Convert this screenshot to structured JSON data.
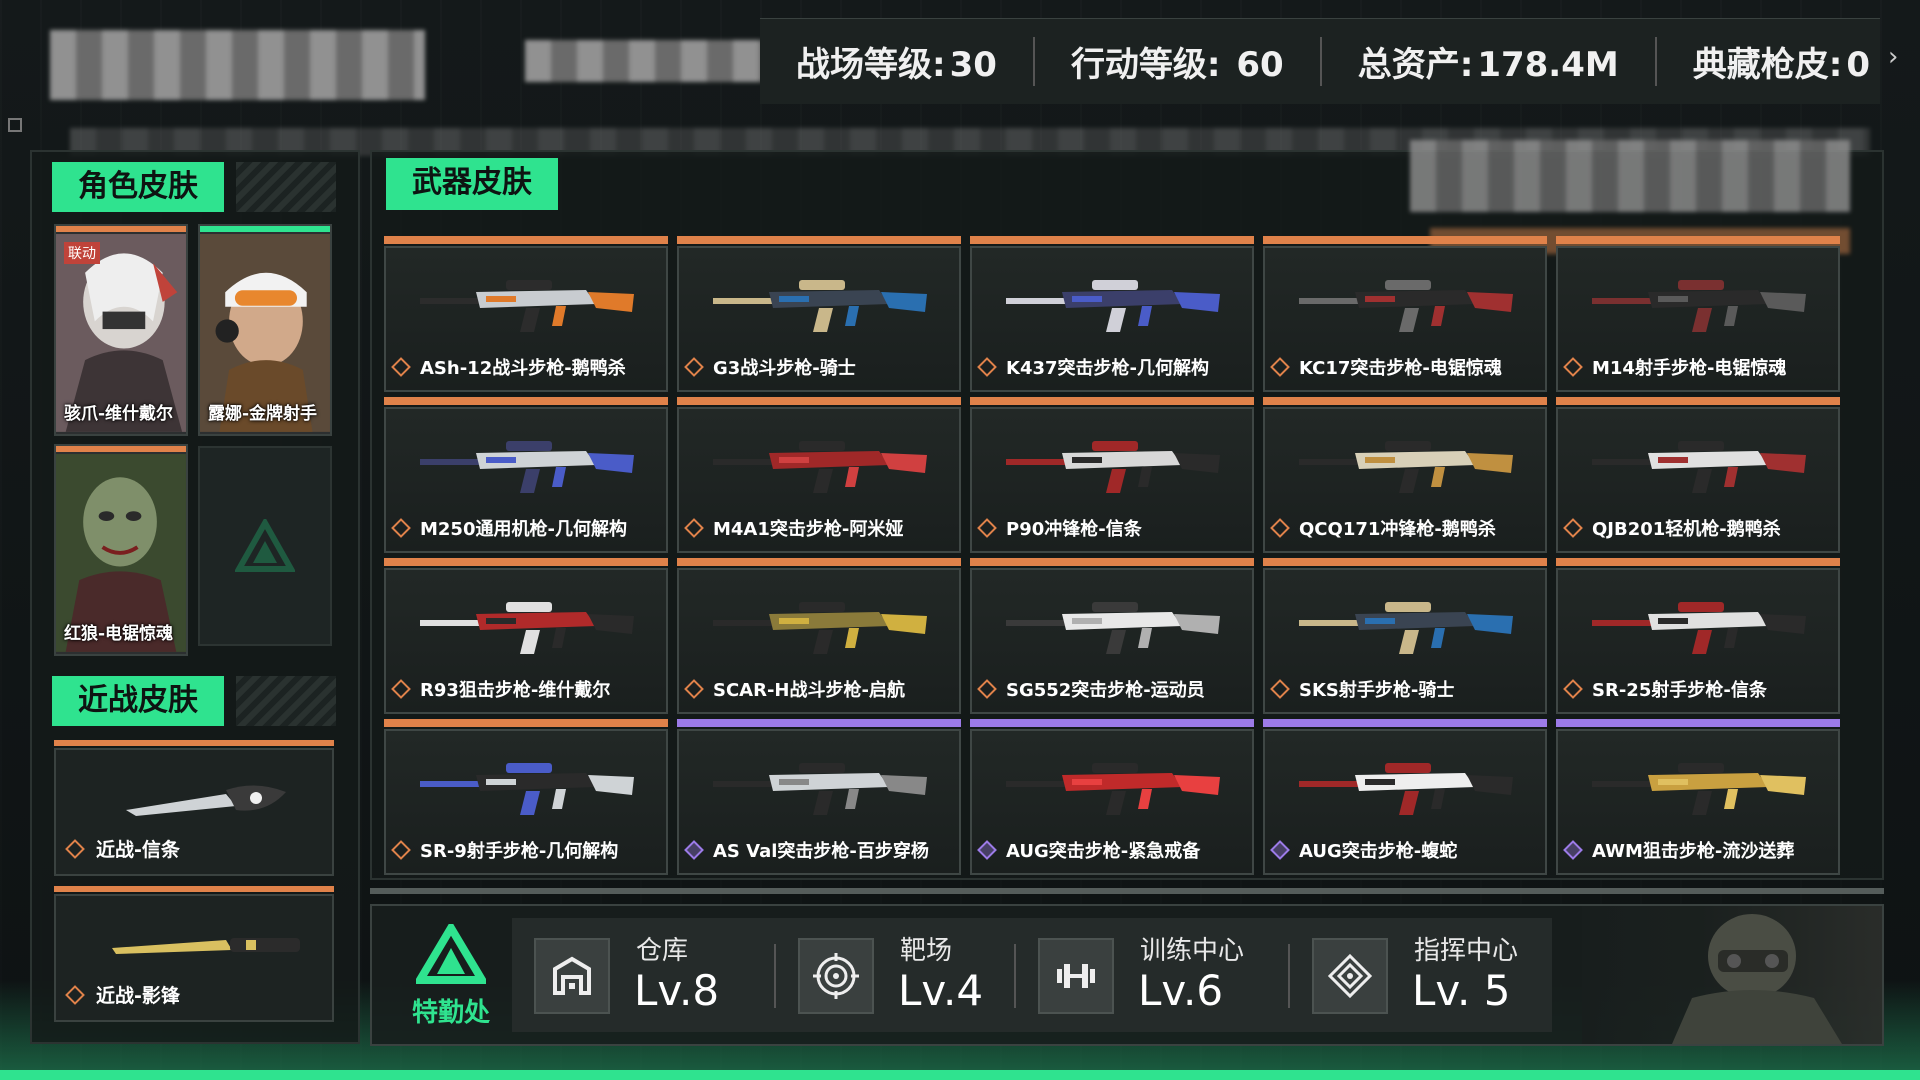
{
  "header": {
    "stats": [
      {
        "label": "战场等级:",
        "value": "30"
      },
      {
        "label": "行动等级: ",
        "value": "60"
      },
      {
        "label": "总资产:",
        "value": "178.4M"
      },
      {
        "label": "典藏枪皮:",
        "value": "0"
      }
    ]
  },
  "sections": {
    "character": "角色皮肤",
    "weapon": "武器皮肤",
    "melee": "近战皮肤"
  },
  "characters": [
    {
      "label": "骇爪-维什戴尔",
      "tag": "联动",
      "bar_color": "#e0824a"
    },
    {
      "label": "露娜-金牌射手",
      "bar_color": "#2fe38f"
    },
    {
      "label": "红狼-电锯惊魂",
      "bar_color": "#e0824a"
    }
  ],
  "melee": [
    {
      "label": "近战-信条"
    },
    {
      "label": "近战-影锋"
    }
  ],
  "weapons": [
    {
      "label": "ASh-12战斗步枪-鹅鸭杀",
      "rarity": "orange"
    },
    {
      "label": "G3战斗步枪-骑士",
      "rarity": "orange"
    },
    {
      "label": "K437突击步枪-几何解构",
      "rarity": "orange"
    },
    {
      "label": "KC17突击步枪-电锯惊魂",
      "rarity": "orange"
    },
    {
      "label": "M14射手步枪-电锯惊魂",
      "rarity": "orange"
    },
    {
      "label": "M250通用机枪-几何解构",
      "rarity": "orange"
    },
    {
      "label": "M4A1突击步枪-阿米娅",
      "rarity": "orange"
    },
    {
      "label": "P90冲锋枪-信条",
      "rarity": "orange"
    },
    {
      "label": "QCQ171冲锋枪-鹅鸭杀",
      "rarity": "orange"
    },
    {
      "label": "QJB201轻机枪-鹅鸭杀",
      "rarity": "orange"
    },
    {
      "label": "R93狙击步枪-维什戴尔",
      "rarity": "orange"
    },
    {
      "label": "SCAR-H战斗步枪-启航",
      "rarity": "orange"
    },
    {
      "label": "SG552突击步枪-运动员",
      "rarity": "orange"
    },
    {
      "label": "SKS射手步枪-骑士",
      "rarity": "orange"
    },
    {
      "label": "SR-25射手步枪-信条",
      "rarity": "orange"
    },
    {
      "label": "SR-9射手步枪-几何解构",
      "rarity": "orange"
    },
    {
      "label": "AS Val突击步枪-百步穿杨",
      "rarity": "purple"
    },
    {
      "label": "AUG突击步枪-紧急戒备",
      "rarity": "purple"
    },
    {
      "label": "AUG突击步枪-蝮蛇",
      "rarity": "purple"
    },
    {
      "label": "AWM狙击步枪-流沙送葬",
      "rarity": "purple"
    }
  ],
  "brand": {
    "text": "特勤处",
    "icon": "delta-logo-icon"
  },
  "facilities": [
    {
      "name": "仓库",
      "level": "Lv.8",
      "icon": "warehouse-icon"
    },
    {
      "name": "靶场",
      "level": "Lv.4",
      "icon": "target-icon"
    },
    {
      "name": "训练中心",
      "level": "Lv.6",
      "icon": "dumbbell-icon"
    },
    {
      "name": "指挥中心",
      "level": "Lv. 5",
      "icon": "command-icon"
    }
  ],
  "colors": {
    "accent": "#2fe38f",
    "rarity_orange": "#e0824a",
    "rarity_purple": "#9c7be8"
  }
}
